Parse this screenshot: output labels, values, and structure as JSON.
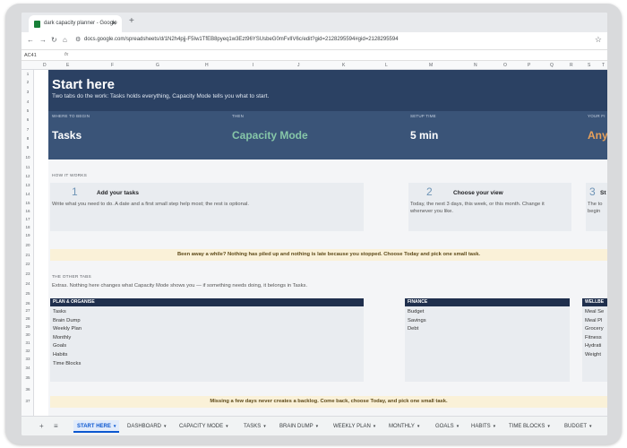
{
  "browser": {
    "tab_title": "dark capacity planner - Google",
    "tab_close": "✕",
    "new_tab": "+",
    "url": "docs.google.com/spreadsheets/d/1N2h4pjj-F5Iw1TfEB8pyeq1w3Ezt96YSUsbeG0mFvlIV6c/edit?gid=2128295594#gid=2128295594"
  },
  "formula_bar": {
    "cell": "AC41",
    "fx": "fx"
  },
  "columns": [
    "D",
    "E",
    "F",
    "G",
    "H",
    "I",
    "J",
    "K",
    "L",
    "M",
    "N",
    "O",
    "P",
    "Q",
    "R",
    "S",
    "T"
  ],
  "rows": [
    "1",
    "2",
    "3",
    "4",
    "5",
    "6",
    "7",
    "8",
    "9",
    "10",
    "11",
    "12",
    "13",
    "14",
    "15",
    "16",
    "17",
    "18",
    "19",
    "20",
    "21",
    "22",
    "23",
    "24",
    "25",
    "26",
    "27",
    "28",
    "29",
    "30",
    "31",
    "32",
    "33",
    "34",
    "35",
    "36",
    "37"
  ],
  "hero": {
    "title": "Start here",
    "subtitle": "Two tabs do the work: Tasks holds everything, Capacity Mode tells you what to start.",
    "kpis": [
      {
        "label": "WHERE TO BEGIN",
        "value": "Tasks",
        "color": "#ffffff"
      },
      {
        "label": "THEN",
        "value": "Capacity Mode",
        "color": "#86c6a8"
      },
      {
        "label": "SETUP TIME",
        "value": "5 min",
        "color": "#ffffff"
      },
      {
        "label": "YOUR FI",
        "value": "Any",
        "color": "#e8a15a"
      }
    ]
  },
  "how": {
    "label": "HOW IT WORKS",
    "steps": [
      {
        "num": "1",
        "title": "Add your tasks",
        "desc": "Write what you need to do. A date and a first small step help most; the rest is optional."
      },
      {
        "num": "2",
        "title": "Choose your view",
        "desc": "Today, the next 3 days, this week, or this month. Change it whenever you like."
      },
      {
        "num": "3",
        "title": "St",
        "desc": "The to begin"
      }
    ]
  },
  "banner1": "Been away a while?  Nothing has piled up and nothing is late because you stopped. Choose Today and pick one small task.",
  "other": {
    "label": "THE OTHER TABS",
    "intro": "Extras. Nothing here changes what Capacity Mode shows you — if something needs doing, it belongs in Tasks.",
    "groups": [
      {
        "head": "PLAN & ORGANISE",
        "items": [
          "Tasks",
          "Brain Dump",
          "Weekly Plan",
          "Monthly",
          "Goals",
          "Habits",
          "Time Blocks"
        ]
      },
      {
        "head": "FINANCE",
        "items": [
          "Budget",
          "Savings",
          "Debt"
        ]
      },
      {
        "head": "WELLBE",
        "items": [
          "Meal Se",
          "Meal Pl",
          "Grocery",
          "Fitness",
          "Hydrati",
          "Weight"
        ]
      }
    ]
  },
  "banner2": "Missing a few days never creates a backlog. Come back, choose Today, and pick one small task.",
  "sheet_tabs": [
    "START HERE",
    "DASHBOARD",
    "CAPACITY MODE",
    "TASKS",
    "BRAIN DUMP",
    "WEEKLY PLAN",
    "MONTHLY",
    "GOALS",
    "HABITS",
    "TIME BLOCKS",
    "BUDGET"
  ],
  "sheet_caret": "▾",
  "sheet_icons": [
    "+",
    "≡"
  ]
}
